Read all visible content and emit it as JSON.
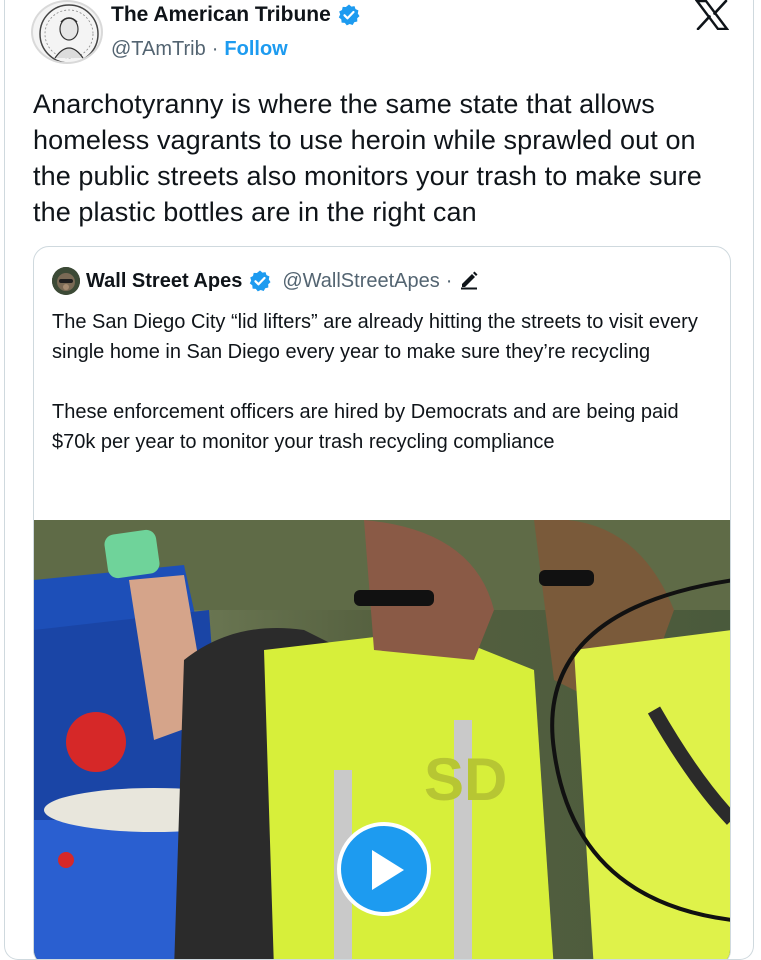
{
  "author": {
    "name": "The American Tribune",
    "handle": "@TAmTrib",
    "separator": "·",
    "follow_label": "Follow",
    "verified_icon": "verified-badge-icon"
  },
  "platform_logo": "x-logo-icon",
  "tweet": {
    "text": "Anarchotyranny is where the same state that allows homeless vagrants to use heroin while sprawled out on the public streets also monitors your trash to make sure the plastic bottles are in the right can"
  },
  "quoted_tweet": {
    "name": "Wall Street Apes",
    "handle": "@WallStreetApes",
    "separator": "·",
    "paragraphs": [
      "The San Diego City “lid lifters” are already hitting the streets to visit every single home in San Diego every year to make sure they’re recycling",
      "These enforcement officers are hired by Democrats and are being paid $70k per year to monitor your trash recycling compliance"
    ],
    "media": {
      "type": "video",
      "play_icon": "play-icon"
    }
  },
  "colors": {
    "accent": "#1d9bf0",
    "text": "#0f1419",
    "muted": "#536471",
    "border": "#cfd9de"
  }
}
